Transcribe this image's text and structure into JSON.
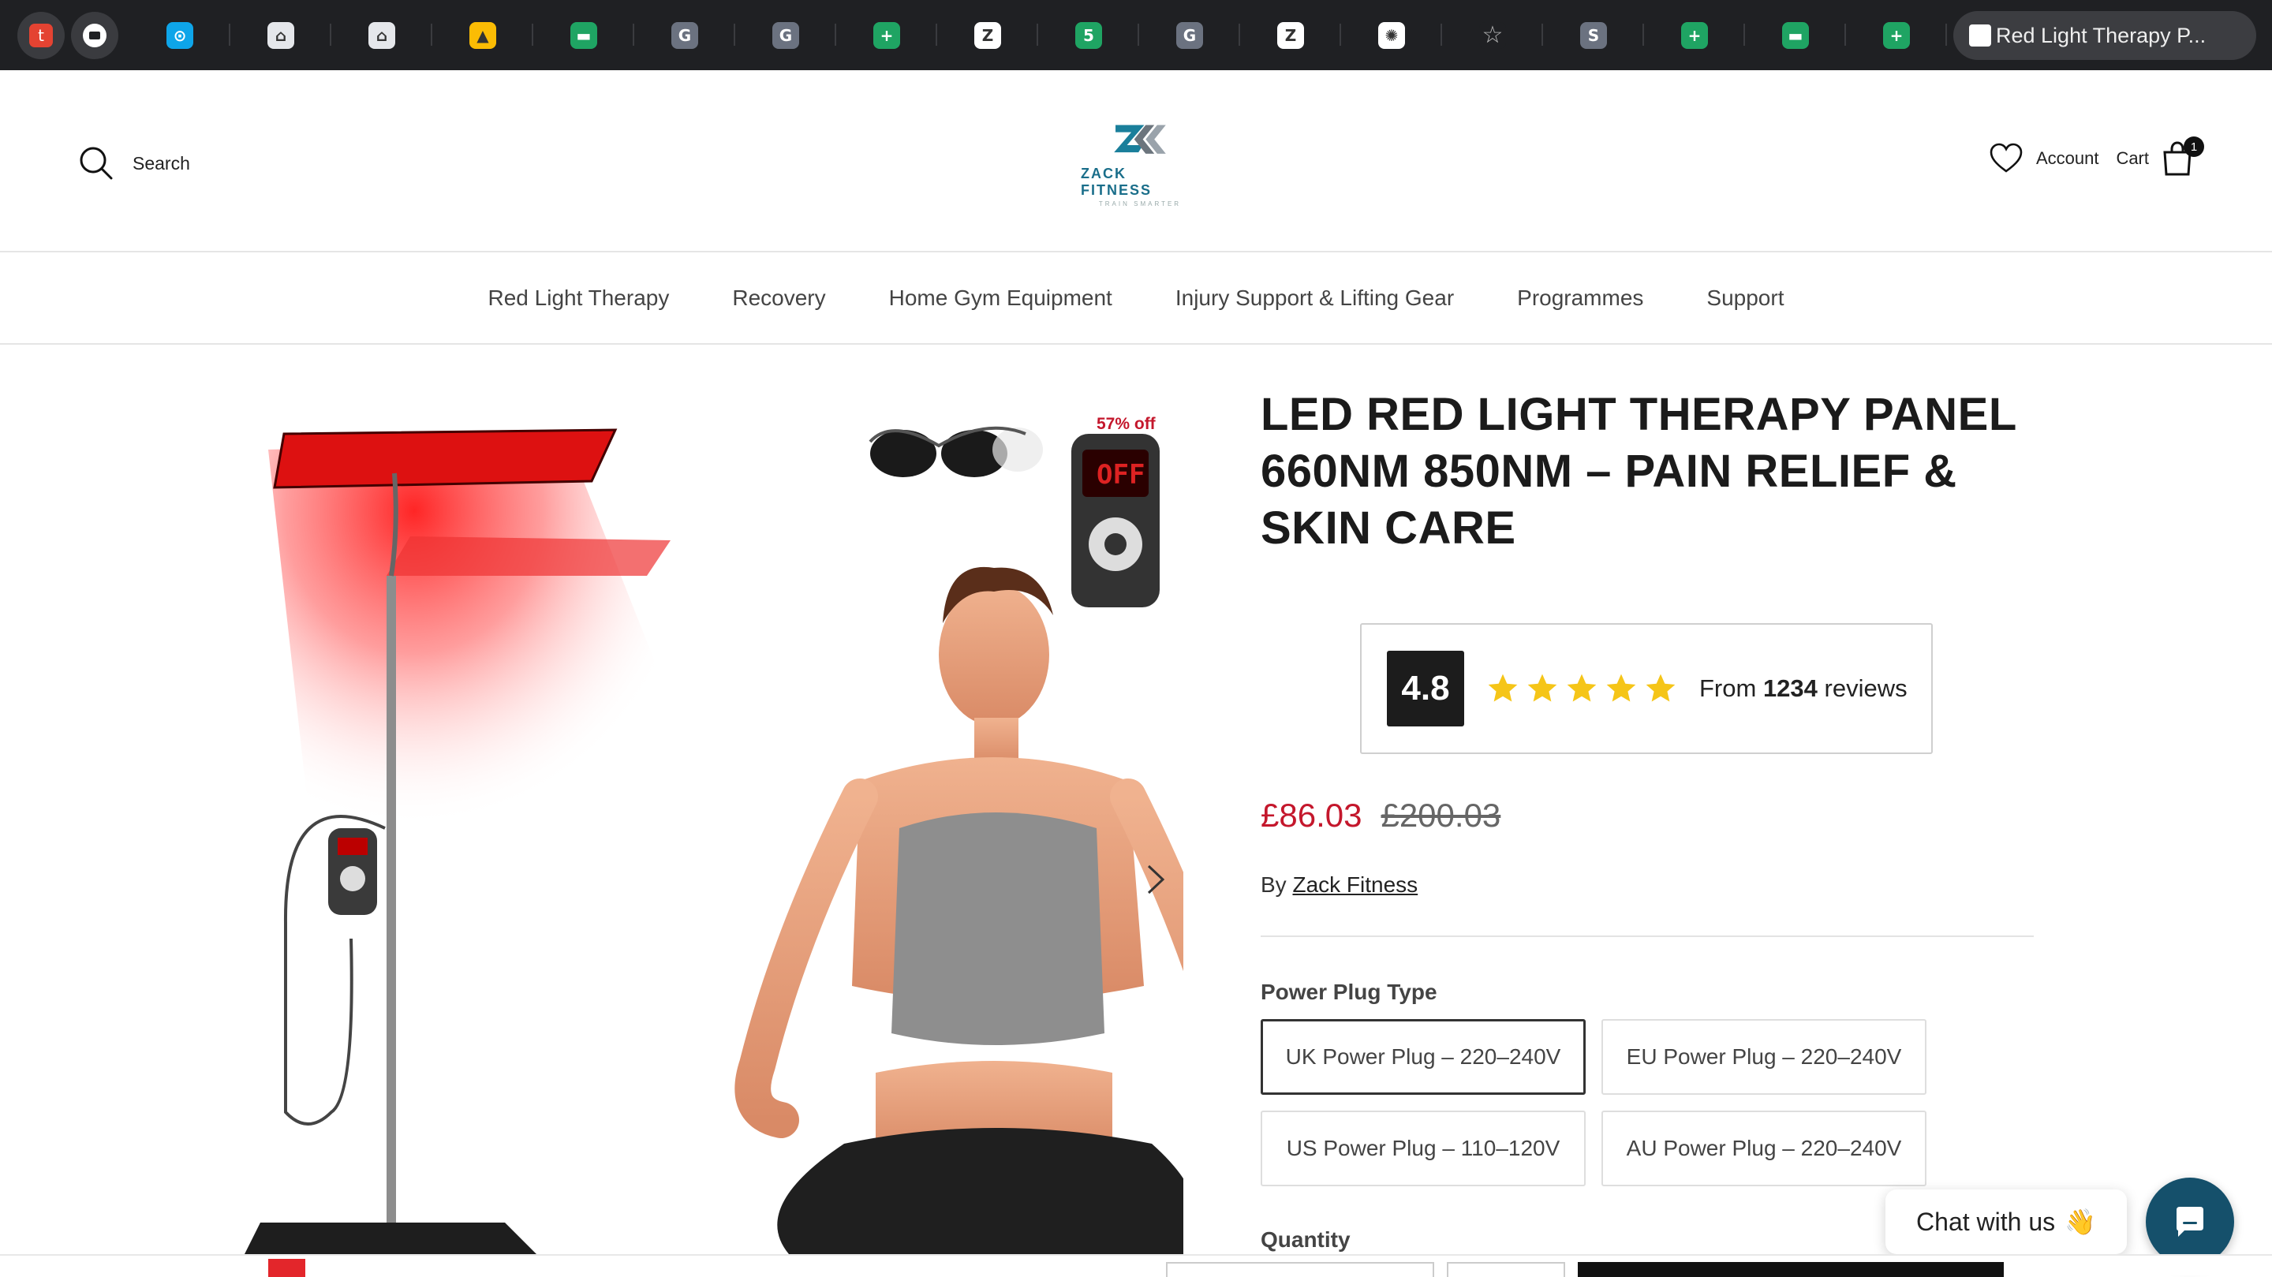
{
  "browser": {
    "pinned_tabs": [
      {
        "name": "todoist-tab",
        "color": "#e44332",
        "glyph": "t"
      },
      {
        "name": "zoom-tab",
        "color": "#ffffff",
        "glyph": "■"
      }
    ],
    "tabs": [
      {
        "name": "tab-1",
        "color": "#0ea5e9",
        "glyph": "⊙"
      },
      {
        "name": "tab-2",
        "color": "#e5e7eb",
        "glyph": "⌂"
      },
      {
        "name": "tab-3",
        "color": "#e5e7eb",
        "glyph": "⌂"
      },
      {
        "name": "tab-google-ads",
        "color": "#fbbc04",
        "glyph": "▲"
      },
      {
        "name": "tab-5",
        "color": "#1fa463",
        "glyph": "▬"
      },
      {
        "name": "tab-6",
        "color": "#6b7280",
        "glyph": "G"
      },
      {
        "name": "tab-7",
        "color": "#6b7280",
        "glyph": "G"
      },
      {
        "name": "tab-sheets-1",
        "color": "#1fa463",
        "glyph": "+"
      },
      {
        "name": "tab-9",
        "color": "#ffffff",
        "glyph": "Z"
      },
      {
        "name": "tab-10",
        "color": "#1fa463",
        "glyph": "5"
      },
      {
        "name": "tab-11",
        "color": "#6b7280",
        "glyph": "G"
      },
      {
        "name": "tab-12",
        "color": "#ffffff",
        "glyph": "Z"
      },
      {
        "name": "tab-chatgpt",
        "color": "#ffffff",
        "glyph": "✺"
      },
      {
        "name": "tab-bookmark",
        "color": "#1f2023",
        "glyph": "☆"
      },
      {
        "name": "tab-15",
        "color": "#6b7280",
        "glyph": "S"
      },
      {
        "name": "tab-sheets-2",
        "color": "#1fa463",
        "glyph": "+"
      },
      {
        "name": "tab-17",
        "color": "#1fa463",
        "glyph": "▬"
      },
      {
        "name": "tab-sheets-3",
        "color": "#1fa463",
        "glyph": "+"
      }
    ],
    "active_tab_title": "Red Light Therapy P..."
  },
  "header": {
    "search_label": "Search",
    "logo_name": "ZACK FITNESS",
    "logo_tagline": "TRAIN SMARTER",
    "account_label": "Account",
    "cart_label": "Cart",
    "cart_count": "1"
  },
  "nav": {
    "items": [
      "Red Light Therapy",
      "Recovery",
      "Home Gym Equipment",
      "Injury Support & Lifting Gear",
      "Programmes",
      "Support"
    ]
  },
  "gallery": {
    "discount_badge": "57% off",
    "device_display": "OFF"
  },
  "product": {
    "title": "LED RED LIGHT THERAPY PANEL 660NM 850NM – PAIN RELIEF & SKIN CARE",
    "rating": "4.8",
    "stars": 5,
    "reviews_prefix": "From ",
    "reviews_count": "1234",
    "reviews_suffix": " reviews",
    "price_now": "£86.03",
    "price_was": "£200.03",
    "by_prefix": "By ",
    "brand": "Zack Fitness",
    "option_label": "Power Plug Type",
    "options": [
      "UK Power Plug – 220–240V",
      "EU Power Plug – 220–240V",
      "US Power Plug – 110–120V",
      "AU Power Plug – 220–240V"
    ],
    "selected_option": "UK Power Plug – 220–240V",
    "quantity_label": "Quantity"
  },
  "chat": {
    "label": "Chat with us",
    "emoji": "👋"
  },
  "colors": {
    "price_red": "#c4172c",
    "chat_blue": "#15506b",
    "star_gold": "#f5c518"
  }
}
